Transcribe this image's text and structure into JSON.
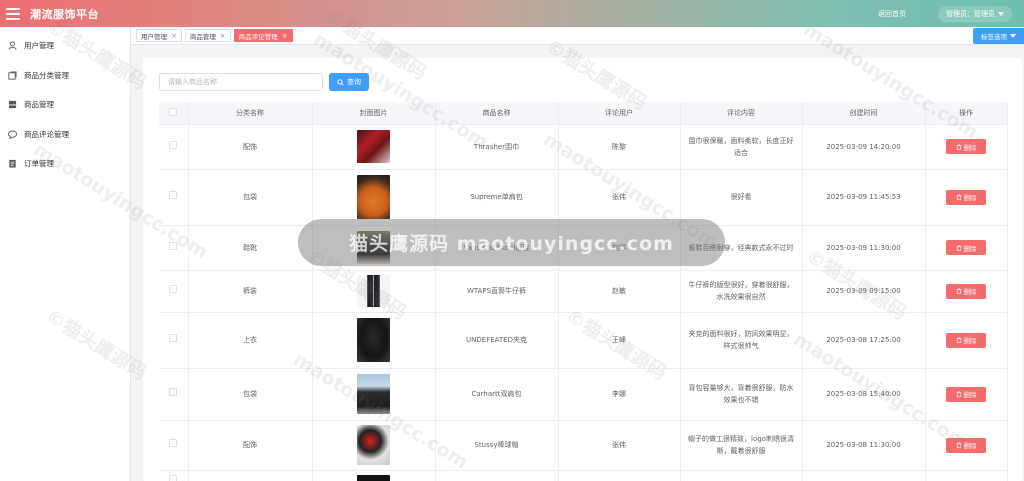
{
  "header": {
    "title": "潮流服饰平台",
    "home_link": "返回首页",
    "admin_label": "管理员：管理员"
  },
  "sidebar": {
    "items": [
      {
        "label": "用户管理",
        "icon": "user-icon"
      },
      {
        "label": "商品分类管理",
        "icon": "category-icon"
      },
      {
        "label": "商品管理",
        "icon": "goods-icon"
      },
      {
        "label": "商品评论管理",
        "icon": "comment-icon"
      },
      {
        "label": "订单管理",
        "icon": "order-icon"
      }
    ]
  },
  "tabs": {
    "items": [
      {
        "label": "用户管理",
        "active": false
      },
      {
        "label": "商品管理",
        "active": false
      },
      {
        "label": "商品评论管理",
        "active": true
      }
    ],
    "close_glyph": "×",
    "options_label": "标签选项"
  },
  "search": {
    "placeholder": "请输入商品名称",
    "button_label": "查询"
  },
  "table": {
    "columns": [
      "",
      "分类名称",
      "封面图片",
      "商品名称",
      "评论用户",
      "评论内容",
      "创建时间",
      "操作"
    ],
    "delete_label": "删除",
    "rows": [
      {
        "category": "配饰",
        "product": "Thrasher围巾",
        "user": "陈黎",
        "content": "围巾很保暖，面料柔软，长度正好适合",
        "time": "2025-03-09 14:20:00",
        "thumb": "scarf"
      },
      {
        "category": "包袋",
        "product": "Supreme单肩包",
        "user": "张伟",
        "content": "很好看",
        "time": "2025-03-09 11:45:53",
        "thumb": "bag"
      },
      {
        "category": "鞋靴",
        "product": "Vans Old Skool板鞋",
        "user": "刘洋",
        "content": "板鞋百搭耐穿，经典款式永不过时",
        "time": "2025-03-09 11:30:00",
        "thumb": "shoe"
      },
      {
        "category": "裤装",
        "product": "WTAPS直筒牛仔裤",
        "user": "赵敏",
        "content": "牛仔裤的版型很好，穿着很舒服，水洗效果很自然",
        "time": "2025-03-09 09:15:00",
        "thumb": "jeans"
      },
      {
        "category": "上衣",
        "product": "UNDEFEATED夹克",
        "user": "王峰",
        "content": "夹克的面料很好，防风效果明显，样式很帅气",
        "time": "2025-03-08 17:25:00",
        "thumb": "jacket"
      },
      {
        "category": "包袋",
        "product": "Carhartt双肩包",
        "user": "李娜",
        "content": "背包容量够大，背着很舒服，防水效果也不错",
        "time": "2025-03-08 15:40:00",
        "thumb": "backpack"
      },
      {
        "category": "配饰",
        "product": "Stussy棒球帽",
        "user": "张伟",
        "content": "帽子的做工很精致，logo刺绣很清晰，戴着很舒服",
        "time": "2025-03-08 11:30:00",
        "thumb": "cap"
      }
    ]
  },
  "watermark": {
    "cn": "©猫头鹰源码",
    "en": "maotouyingcc.com",
    "banner": "猫头鹰源码 maotouyingcc.com"
  }
}
